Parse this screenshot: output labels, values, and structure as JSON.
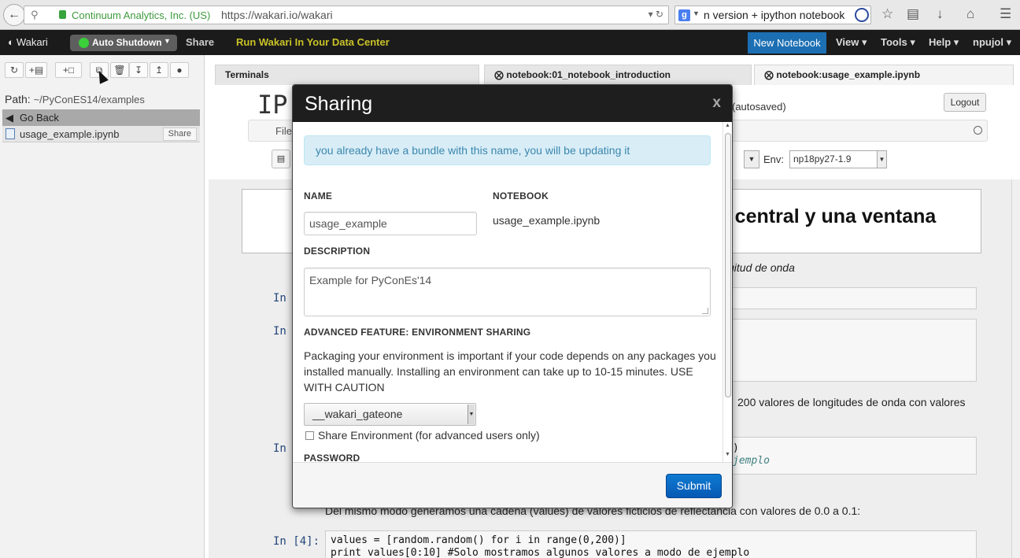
{
  "browser": {
    "org": "Continuum Analytics, Inc. (US)",
    "url": "https://wakari.io/wakari",
    "search": "n version + ipython notebook"
  },
  "app": {
    "brand": "Wakari",
    "auto_shutdown": "Auto Shutdown",
    "share": "Share",
    "run_in_dc": "Run Wakari In Your Data Center",
    "new_notebook": "New Notebook",
    "menus": [
      "View",
      "Tools",
      "Help",
      "npujol"
    ]
  },
  "sidebar": {
    "path_label": "Path:",
    "path": "~/PyConES14/examples",
    "go_back": "Go Back",
    "files": [
      {
        "name": "usage_example.ipynb",
        "share": "Share"
      }
    ]
  },
  "tabs": [
    {
      "label": "Terminals"
    },
    {
      "label": "notebook:01_notebook_introduction"
    },
    {
      "label": "notebook:usage_example.ipynb"
    }
  ],
  "notebook": {
    "logo": "IP",
    "autosaved": "(autosaved)",
    "logout": "Logout",
    "menu_file": "File",
    "env_label": "Env:",
    "env_value": "np18py27-1.9",
    "heading": "r central y una ventana",
    "italic": "gitud de onda",
    "text1": "200 valores de longitudes de onda con valores",
    "text2": "Del mismo modo generamos una cadena (values) de valores ficticios de reflectancia con valores de 0.0 a 0.1:",
    "prompt_in": "In",
    "prompt_in4": "In [4]:",
    "code_line1": "values = [random.random() for i in range(0,200)]",
    "code_line2": "print values[0:10] #Solo mostramos algunos valores a modo de ejemplo",
    "code_frag1": ")",
    "code_frag2": "jemplo"
  },
  "modal": {
    "title": "Sharing",
    "close": "x",
    "alert": "you already have a bundle with this name, you will be updating it",
    "name_label": "NAME",
    "name_value": "usage_example",
    "notebook_label": "NOTEBOOK",
    "notebook_value": "usage_example.ipynb",
    "description_label": "DESCRIPTION",
    "description_value": "Example for PyConEs'14",
    "advanced_label": "ADVANCED FEATURE: ENVIRONMENT SHARING",
    "advanced_text": "Packaging your environment is important if your code depends on any packages you installed manually. Installing an environment can take up to 10-15 minutes. USE WITH CAUTION",
    "env_select": "__wakari_gateone",
    "share_env": "Share Environment (for advanced users only)",
    "password_label": "PASSWORD",
    "submit": "Submit"
  }
}
